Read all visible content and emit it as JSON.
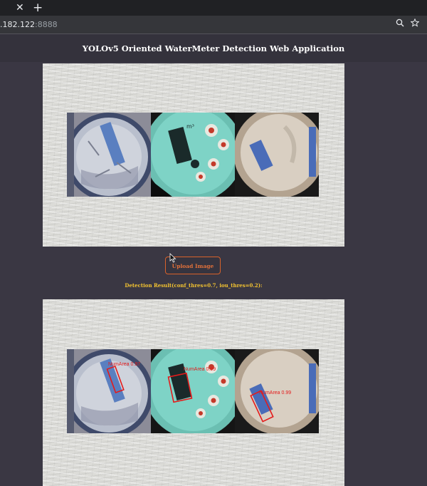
{
  "browser": {
    "tab_close": "✕",
    "new_tab": "+",
    "url_host": ".182.122",
    "url_port": ":8888",
    "zoom_icon": "zoom-icon",
    "star_icon": "bookmark-star-icon"
  },
  "page": {
    "title": "YOLOv5 Oriented WaterMeter Detection Web Application",
    "upload_button": "Upload Image",
    "result_label": "Detection Result(conf_thres=0.7, iou_thres=0.2):"
  },
  "detections": [
    {
      "label": "NumArea 0.97",
      "meter": 1
    },
    {
      "label": "NumArea 0.99",
      "meter": 2
    },
    {
      "label": "NumArea 0.99",
      "meter": 3
    }
  ],
  "colors": {
    "page_bg": "#3a3743",
    "button_border": "#d9622a",
    "result_text": "#f2c230",
    "detection_box": "#e41b1b"
  }
}
